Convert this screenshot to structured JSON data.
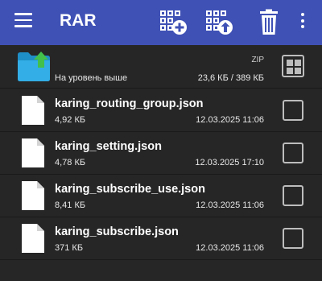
{
  "appbar": {
    "title": "RAR",
    "menu_icon": "hamburger-menu-icon",
    "add_icon": "archive-add-icon",
    "extract_icon": "archive-extract-icon",
    "delete_icon": "trash-icon",
    "more_icon": "more-vertical-icon",
    "background": "#3f51b5"
  },
  "parent": {
    "label": "На уровень выше",
    "type": "ZIP",
    "size": "23,6 КБ / 389 КБ",
    "icon": "folder-up-icon"
  },
  "files": [
    {
      "name": "karing_routing_group.json",
      "size": "4,92 КБ",
      "date": "12.03.2025 11:06"
    },
    {
      "name": "karing_setting.json",
      "size": "4,78 КБ",
      "date": "12.03.2025 17:10"
    },
    {
      "name": "karing_subscribe_use.json",
      "size": "8,41 КБ",
      "date": "12.03.2025 11:06"
    },
    {
      "name": "karing_subscribe.json",
      "size": "371 КБ",
      "date": "12.03.2025 11:06"
    }
  ],
  "colors": {
    "background": "#262626",
    "folder": "#29a8e0",
    "up_arrow": "#43c04b",
    "checkbox_border": "#bdbdbd"
  }
}
